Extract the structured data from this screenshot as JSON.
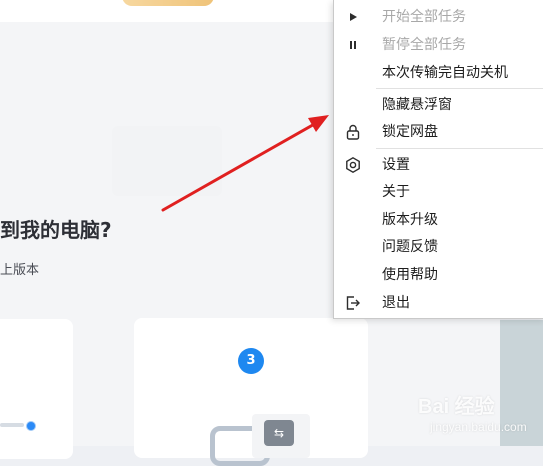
{
  "page": {
    "headline": "到我的电脑?",
    "subtext": "上版本",
    "step_number": "3"
  },
  "menu": {
    "items": [
      {
        "label": "开始全部任务",
        "icon": "play-icon",
        "enabled": false
      },
      {
        "label": "暂停全部任务",
        "icon": "pause-icon",
        "enabled": false
      },
      {
        "label": "本次传输完自动关机",
        "icon": "",
        "enabled": true
      },
      {
        "label": "隐藏悬浮窗",
        "icon": "",
        "enabled": true
      },
      {
        "label": "锁定网盘",
        "icon": "lock-icon",
        "enabled": true
      },
      {
        "label": "设置",
        "icon": "gear-icon",
        "enabled": true
      },
      {
        "label": "关于",
        "icon": "",
        "enabled": true
      },
      {
        "label": "版本升级",
        "icon": "",
        "enabled": true
      },
      {
        "label": "问题反馈",
        "icon": "",
        "enabled": true
      },
      {
        "label": "使用帮助",
        "icon": "",
        "enabled": true
      },
      {
        "label": "退出",
        "icon": "exit-icon",
        "enabled": true
      }
    ]
  },
  "watermark": {
    "line1": "Bai 经验",
    "line2": "jingyan.baidu.com"
  },
  "colors": {
    "accent_blue": "#1e88f0",
    "arrow_red": "#e02020",
    "disabled_text": "#a8a8a8"
  }
}
